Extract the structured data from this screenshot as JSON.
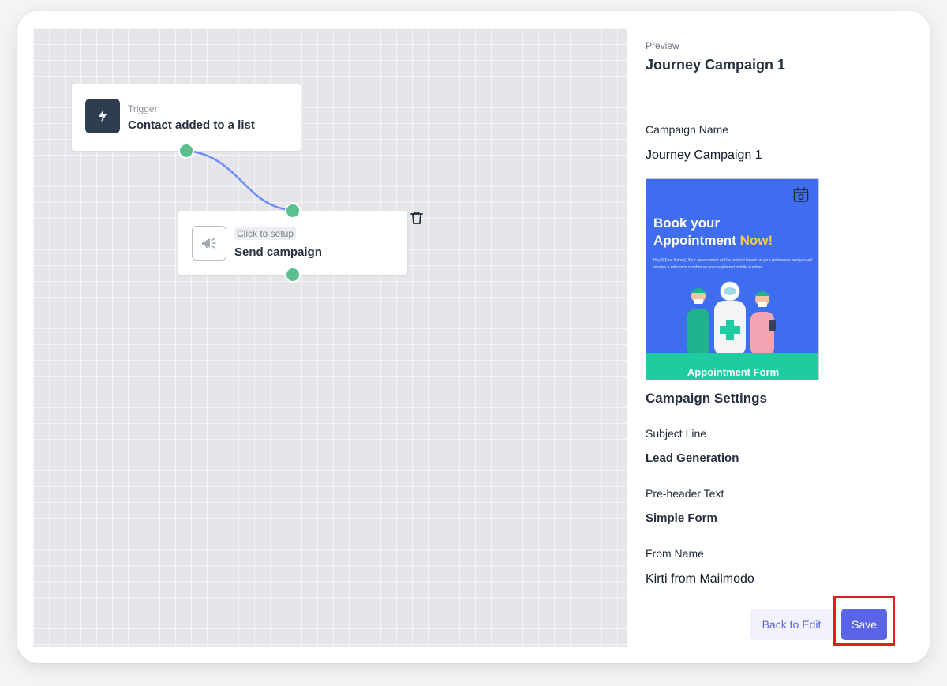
{
  "canvas": {
    "trigger_node": {
      "subtitle": "Trigger",
      "title": "Contact added to a list",
      "icon": "lightning-icon"
    },
    "send_node": {
      "badge": "Click to setup",
      "title": "Send campaign",
      "icon": "megaphone-icon",
      "delete_icon": "trash-icon"
    },
    "colors": {
      "connector": "#6b8ef5",
      "handle": "#5ac18e"
    }
  },
  "panel": {
    "preview_label": "Preview",
    "preview_title": "Journey Campaign 1",
    "campaign_name_label": "Campaign Name",
    "campaign_name_value": "Journey Campaign 1",
    "email_preview": {
      "heading_line1": "Book your",
      "heading_line2": "Appointment",
      "heading_highlight": "Now!",
      "body": "Hey ${First Name}, Your appointment will be booked based on your preference and you will receive a reference number on your registered mobile number",
      "footer": "Appointment Form",
      "colors": {
        "background": "#3e6df0",
        "footer": "#1fcba1",
        "highlight": "#f7c948"
      }
    },
    "settings_title": "Campaign Settings",
    "subject_line_label": "Subject Line",
    "subject_line_value": "Lead Generation",
    "preheader_label": "Pre-header Text",
    "preheader_value": "Simple Form",
    "from_name_label": "From Name",
    "from_name_value": "Kirti from Mailmodo",
    "back_button": "Back to Edit",
    "save_button": "Save",
    "colors": {
      "accent": "#5b63e6",
      "highlight_box": "#e11d1d"
    }
  }
}
